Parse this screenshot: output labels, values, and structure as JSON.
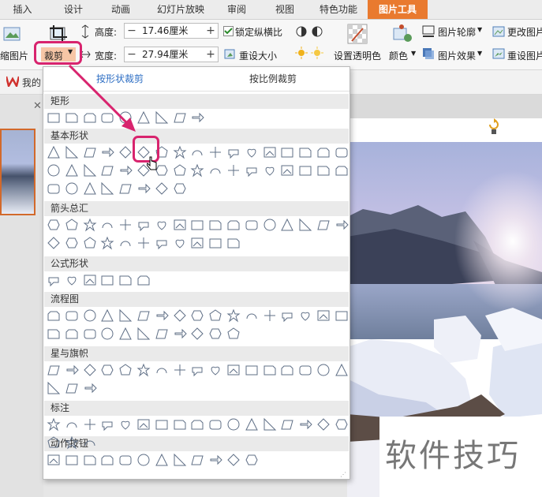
{
  "tabs": [
    "插入",
    "设计",
    "动画",
    "幻灯片放映",
    "审阅",
    "视图",
    "特色功能",
    "图片工具"
  ],
  "active_tab_index": 7,
  "ribbon": {
    "compress_label": "缩图片",
    "crop_label": "裁剪",
    "height_label": "高度:",
    "height_value": "17.46厘米",
    "width_label": "宽度:",
    "width_value": "27.94厘米",
    "lock_ratio_label": "锁定纵横比",
    "reset_size_label": "重设大小",
    "set_transparent_label": "设置透明色",
    "color_label": "颜色",
    "outline_label": "图片轮廓",
    "effects_label": "图片效果",
    "change_pic_label": "更改图片",
    "reset_pic_label": "重设图片"
  },
  "docbar": {
    "label": "我的"
  },
  "dropdown": {
    "subtabs": [
      "按形状裁剪",
      "按比例裁剪"
    ],
    "active_subtab": 0,
    "sections": [
      {
        "title": "矩形",
        "count": 9
      },
      {
        "title": "基本形状",
        "count": 42
      },
      {
        "title": "箭头总汇",
        "count": 28
      },
      {
        "title": "公式形状",
        "count": 6
      },
      {
        "title": "流程图",
        "count": 28
      },
      {
        "title": "星与旗帜",
        "count": 20
      },
      {
        "title": "标注",
        "count": 20
      },
      {
        "title": "动作按钮",
        "count": 12
      }
    ],
    "highlighted_shape": "diamond"
  },
  "watermark": "软件技巧",
  "colors": {
    "accent": "#e97a2f",
    "highlight": "#d8246e",
    "subtab_active": "#2f6fc4"
  }
}
